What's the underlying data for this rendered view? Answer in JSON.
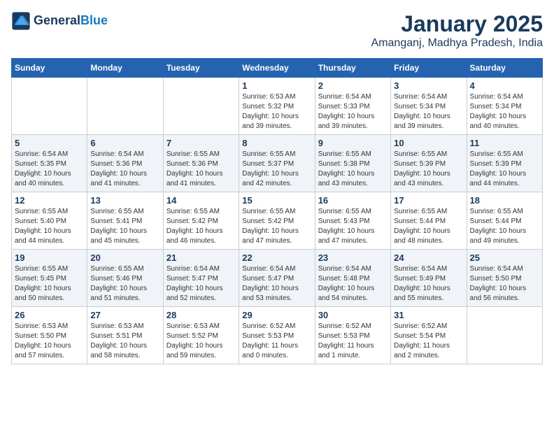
{
  "header": {
    "logo_line1": "General",
    "logo_line2": "Blue",
    "month_title": "January 2025",
    "location": "Amanganj, Madhya Pradesh, India"
  },
  "weekdays": [
    "Sunday",
    "Monday",
    "Tuesday",
    "Wednesday",
    "Thursday",
    "Friday",
    "Saturday"
  ],
  "weeks": [
    [
      {
        "day": "",
        "info": ""
      },
      {
        "day": "",
        "info": ""
      },
      {
        "day": "",
        "info": ""
      },
      {
        "day": "1",
        "info": "Sunrise: 6:53 AM\nSunset: 5:32 PM\nDaylight: 10 hours\nand 39 minutes."
      },
      {
        "day": "2",
        "info": "Sunrise: 6:54 AM\nSunset: 5:33 PM\nDaylight: 10 hours\nand 39 minutes."
      },
      {
        "day": "3",
        "info": "Sunrise: 6:54 AM\nSunset: 5:34 PM\nDaylight: 10 hours\nand 39 minutes."
      },
      {
        "day": "4",
        "info": "Sunrise: 6:54 AM\nSunset: 5:34 PM\nDaylight: 10 hours\nand 40 minutes."
      }
    ],
    [
      {
        "day": "5",
        "info": "Sunrise: 6:54 AM\nSunset: 5:35 PM\nDaylight: 10 hours\nand 40 minutes."
      },
      {
        "day": "6",
        "info": "Sunrise: 6:54 AM\nSunset: 5:36 PM\nDaylight: 10 hours\nand 41 minutes."
      },
      {
        "day": "7",
        "info": "Sunrise: 6:55 AM\nSunset: 5:36 PM\nDaylight: 10 hours\nand 41 minutes."
      },
      {
        "day": "8",
        "info": "Sunrise: 6:55 AM\nSunset: 5:37 PM\nDaylight: 10 hours\nand 42 minutes."
      },
      {
        "day": "9",
        "info": "Sunrise: 6:55 AM\nSunset: 5:38 PM\nDaylight: 10 hours\nand 43 minutes."
      },
      {
        "day": "10",
        "info": "Sunrise: 6:55 AM\nSunset: 5:39 PM\nDaylight: 10 hours\nand 43 minutes."
      },
      {
        "day": "11",
        "info": "Sunrise: 6:55 AM\nSunset: 5:39 PM\nDaylight: 10 hours\nand 44 minutes."
      }
    ],
    [
      {
        "day": "12",
        "info": "Sunrise: 6:55 AM\nSunset: 5:40 PM\nDaylight: 10 hours\nand 44 minutes."
      },
      {
        "day": "13",
        "info": "Sunrise: 6:55 AM\nSunset: 5:41 PM\nDaylight: 10 hours\nand 45 minutes."
      },
      {
        "day": "14",
        "info": "Sunrise: 6:55 AM\nSunset: 5:42 PM\nDaylight: 10 hours\nand 46 minutes."
      },
      {
        "day": "15",
        "info": "Sunrise: 6:55 AM\nSunset: 5:42 PM\nDaylight: 10 hours\nand 47 minutes."
      },
      {
        "day": "16",
        "info": "Sunrise: 6:55 AM\nSunset: 5:43 PM\nDaylight: 10 hours\nand 47 minutes."
      },
      {
        "day": "17",
        "info": "Sunrise: 6:55 AM\nSunset: 5:44 PM\nDaylight: 10 hours\nand 48 minutes."
      },
      {
        "day": "18",
        "info": "Sunrise: 6:55 AM\nSunset: 5:44 PM\nDaylight: 10 hours\nand 49 minutes."
      }
    ],
    [
      {
        "day": "19",
        "info": "Sunrise: 6:55 AM\nSunset: 5:45 PM\nDaylight: 10 hours\nand 50 minutes."
      },
      {
        "day": "20",
        "info": "Sunrise: 6:55 AM\nSunset: 5:46 PM\nDaylight: 10 hours\nand 51 minutes."
      },
      {
        "day": "21",
        "info": "Sunrise: 6:54 AM\nSunset: 5:47 PM\nDaylight: 10 hours\nand 52 minutes."
      },
      {
        "day": "22",
        "info": "Sunrise: 6:54 AM\nSunset: 5:47 PM\nDaylight: 10 hours\nand 53 minutes."
      },
      {
        "day": "23",
        "info": "Sunrise: 6:54 AM\nSunset: 5:48 PM\nDaylight: 10 hours\nand 54 minutes."
      },
      {
        "day": "24",
        "info": "Sunrise: 6:54 AM\nSunset: 5:49 PM\nDaylight: 10 hours\nand 55 minutes."
      },
      {
        "day": "25",
        "info": "Sunrise: 6:54 AM\nSunset: 5:50 PM\nDaylight: 10 hours\nand 56 minutes."
      }
    ],
    [
      {
        "day": "26",
        "info": "Sunrise: 6:53 AM\nSunset: 5:50 PM\nDaylight: 10 hours\nand 57 minutes."
      },
      {
        "day": "27",
        "info": "Sunrise: 6:53 AM\nSunset: 5:51 PM\nDaylight: 10 hours\nand 58 minutes."
      },
      {
        "day": "28",
        "info": "Sunrise: 6:53 AM\nSunset: 5:52 PM\nDaylight: 10 hours\nand 59 minutes."
      },
      {
        "day": "29",
        "info": "Sunrise: 6:52 AM\nSunset: 5:53 PM\nDaylight: 11 hours\nand 0 minutes."
      },
      {
        "day": "30",
        "info": "Sunrise: 6:52 AM\nSunset: 5:53 PM\nDaylight: 11 hours\nand 1 minute."
      },
      {
        "day": "31",
        "info": "Sunrise: 6:52 AM\nSunset: 5:54 PM\nDaylight: 11 hours\nand 2 minutes."
      },
      {
        "day": "",
        "info": ""
      }
    ]
  ]
}
